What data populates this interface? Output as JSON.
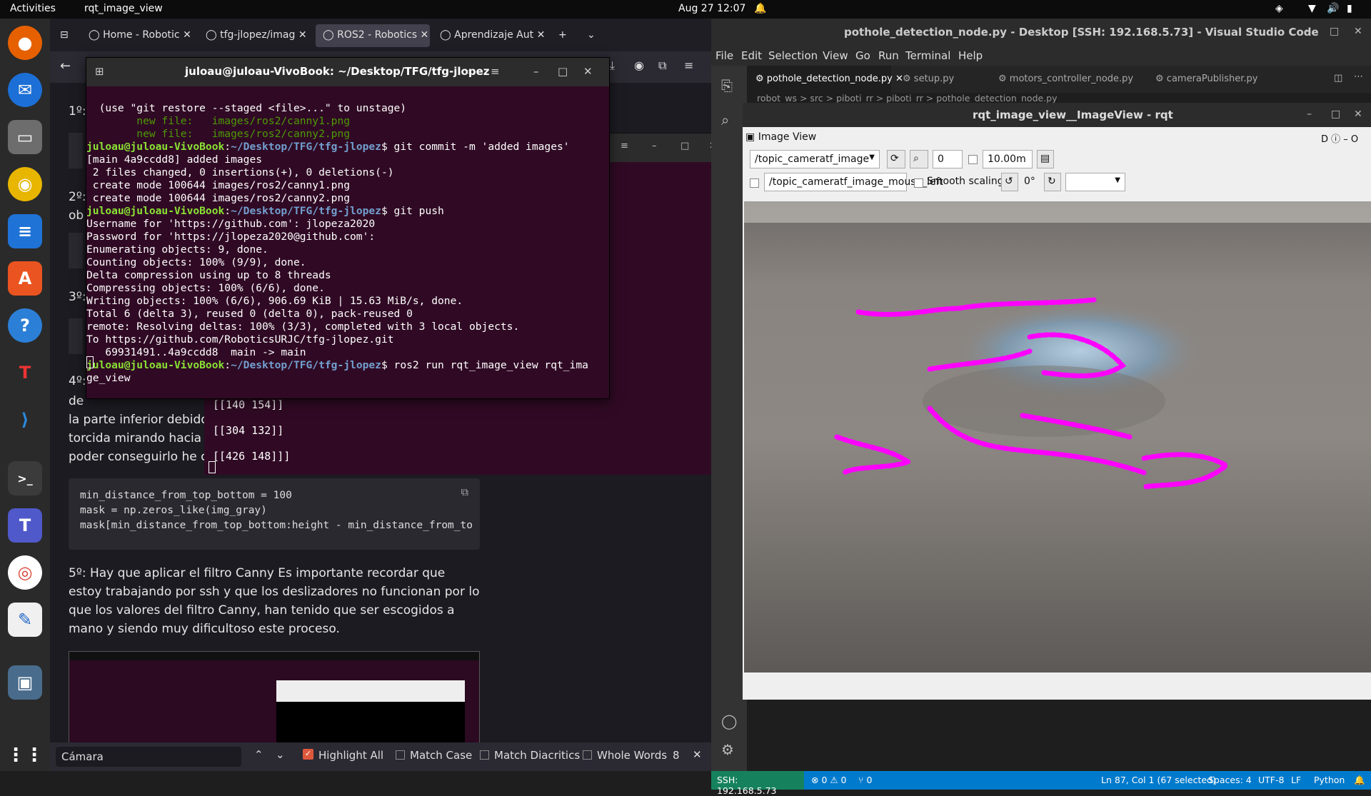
{
  "topbar": {
    "activities": "Activities",
    "app": "rqt_image_view",
    "clock": "Aug 27  12:07"
  },
  "firefox": {
    "tabs": [
      "Home - Robotic",
      "tfg-jlopez/imag",
      "ROS2 - Robotics",
      "Aprendizaje Aut"
    ],
    "article": {
      "step1": "1º:",
      "step2": "2º:",
      "step2b": "ob",
      "step3": "3º:",
      "step4": "4º:",
      "step4b": "de",
      "line_a": "la parte inferior debido",
      "line_b": "torcida mirando hacia e",
      "line_c": "poder conseguirlo he c",
      "code1": "min_distance_from_top_bottom = 100",
      "code2": "mask = np.zeros_like(img_gray)",
      "code3": "mask[min_distance_from_top_bottom:height - min_distance_from_to",
      "para5": "5º: Hay que aplicar el filtro Canny Es importante recordar que estoy trabajando por ssh y que los deslizadores no funcionan por lo que los valores del filtro Canny, han tenido que ser escogidos a mano y siendo muy dificultoso este proceso."
    },
    "findbar": {
      "query": "Cámara",
      "highlight_all": "Highlight All",
      "match_case": "Match Case",
      "match_diacritics": "Match Diacritics",
      "whole_words": "Whole Words",
      "count": "8"
    }
  },
  "terminal": {
    "title": "juloau@juloau-VivoBook: ~/Desktop/TFG/tfg-jlopez",
    "user": "juloau@juloau-VivoBook",
    "path": "~/Desktop/TFG/tfg-jlopez",
    "lines": [
      "  (use \"git restore --staged <file>...\" to unstage)",
      "        new file:   images/ros2/canny1.png",
      "        new file:   images/ros2/canny2.png",
      "",
      "$ git commit -m 'added images'",
      "[main 4a9ccdd8] added images",
      " 2 files changed, 0 insertions(+), 0 deletions(-)",
      " create mode 100644 images/ros2/canny1.png",
      " create mode 100644 images/ros2/canny2.png",
      "$ git push",
      "Username for 'https://github.com': jlopeza2020",
      "Password for 'https://jlopeza2020@github.com':",
      "Enumerating objects: 9, done.",
      "Counting objects: 100% (9/9), done.",
      "Delta compression using up to 8 threads",
      "Compressing objects: 100% (6/6), done.",
      "Writing objects: 100% (6/6), 906.69 KiB | 15.63 MiB/s, done.",
      "Total 6 (delta 3), reused 0 (delta 0), pack-reused 0",
      "remote: Resolving deltas: 100% (3/3), completed with 3 local objects.",
      "To https://github.com/RoboticsURJC/tfg-jlopez.git",
      "   69931491..4a9ccdd8  main -> main",
      "$ ros2 run rqt_image_view rqt_ima",
      "ge_view"
    ],
    "second_output": [
      "[[140 154]]",
      "[[304 132]]",
      "[[426 148]]]"
    ]
  },
  "vscode": {
    "title": "pothole_detection_node.py - Desktop [SSH: 192.168.5.73] - Visual Studio Code",
    "menu": [
      "File",
      "Edit",
      "Selection",
      "View",
      "Go",
      "Run",
      "Terminal",
      "Help"
    ],
    "tabs": [
      "pothole_detection_node.py",
      "setup.py",
      "motors_controller_node.py",
      "cameraPublisher.py"
    ],
    "breadcrumb": "robot_ws > src > piboti_rr > piboti_rr > pothole_detection_node.py",
    "status": {
      "ssh": "SSH: 192.168.5.73",
      "problems": "⊗ 0 ⚠ 0",
      "ports": "⑂ 0",
      "cursor": "Ln 87, Col 1 (67 selected)",
      "spaces": "Spaces: 4",
      "encoding": "UTF-8",
      "eol": "LF",
      "lang": "Python"
    }
  },
  "rqt": {
    "title": "rqt_image_view__ImageView - rqt",
    "panel": "Image View",
    "topic": "/topic_cameratf_image",
    "zoom": "0",
    "max_range": "10.00m",
    "mouse_topic": "/topic_cameratf_image_mouse_left",
    "smooth": "Smooth scaling",
    "rotation": "0°",
    "corner": "D"
  }
}
